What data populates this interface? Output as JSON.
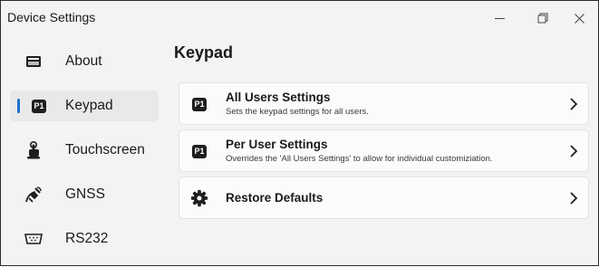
{
  "window": {
    "title": "Device Settings",
    "controls": [
      "minimize-icon",
      "restore-icon",
      "close-icon"
    ]
  },
  "sidebar": {
    "selected": "Keypad",
    "accent_color": "#1f6fce",
    "items": [
      {
        "label": "About",
        "icon": "info-card-icon"
      },
      {
        "label": "Keypad",
        "icon": "p1-key-icon"
      },
      {
        "label": "Touchscreen",
        "icon": "touch-hand-icon"
      },
      {
        "label": "GNSS",
        "icon": "satellite-icon"
      },
      {
        "label": "RS232",
        "icon": "serial-port-icon"
      }
    ]
  },
  "main": {
    "title": "Keypad",
    "cards": [
      {
        "icon": "p1-key-icon",
        "badge": "P1",
        "title": "All Users Settings",
        "subtitle": "Sets the keypad settings for all users."
      },
      {
        "icon": "p1-key-icon",
        "badge": "P1",
        "title": "Per User Settings",
        "subtitle": "Overrides the 'All Users Settings' to allow for individual customiziation."
      },
      {
        "icon": "gear-icon",
        "title": "Restore Defaults"
      }
    ]
  }
}
